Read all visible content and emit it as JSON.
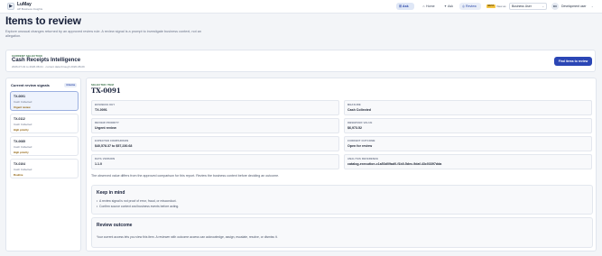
{
  "brand": {
    "logo_glyph": "▶",
    "name": "LuMay",
    "subtitle": "AP Business Insights"
  },
  "nav": {
    "ask_main": {
      "icon": "menu-icon",
      "glyph": "☰",
      "label": "Ask"
    },
    "home": {
      "icon": "home-icon",
      "glyph": "⌂",
      "label": "Home"
    },
    "ask": {
      "icon": "chat-icon",
      "glyph": "✦",
      "label": "Ask"
    },
    "review": {
      "icon": "review-icon",
      "glyph": "◎",
      "label": "Review"
    }
  },
  "beta_badge": "BETA",
  "view_as_label": "View as",
  "role_select": {
    "value": "Business User",
    "chevron": "⌄"
  },
  "user": {
    "initials": "DU",
    "name": "Development user",
    "chevron": "⌄"
  },
  "page": {
    "title": "Items to review",
    "description": "Explore unusual changes returned by an approved review rule. A review signal is a prompt to investigate business context, not an allegation."
  },
  "current_selection": {
    "eyebrow": "CURRENT SELECTION",
    "title": "Cash Receipts Intelligence",
    "meta": "2026-07-01 to 2026-08-31 · current data through 2026-08-09",
    "button_label": "Find items to review"
  },
  "signals": {
    "title": "Current review signals",
    "count_label": "4 items",
    "items": [
      {
        "id": "TX-0091",
        "area": "Cash Collected",
        "priority": "Urgent review"
      },
      {
        "id": "TX-0112",
        "area": "Cash Collected",
        "priority": "High priority"
      },
      {
        "id": "TX-0085",
        "area": "Cash Collected",
        "priority": "High priority"
      },
      {
        "id": "TX-0104",
        "area": "Cash Collected",
        "priority": "Routine"
      }
    ]
  },
  "selected": {
    "eyebrow": "SELECTED ITEM",
    "title": "TX-0091",
    "fields": [
      {
        "label": "BUSINESS KEY",
        "value": "TX-0091"
      },
      {
        "label": "MEASURE",
        "value": "Cash Collected"
      },
      {
        "label": "REVIEW PRIORITY",
        "value": "Urgent review"
      },
      {
        "label": "OBSERVED VALUE",
        "value": "$6,973.52"
      },
      {
        "label": "EXPECTED COMPARISON",
        "value": "$40,578.37 to $57,230.68"
      },
      {
        "label": "CURRENT OUTCOME",
        "value": "Open for review"
      },
      {
        "label": "DATA VERSION",
        "value": "1.1.0"
      },
      {
        "label": "ANALYSIS REFERENCE",
        "value": "catalog-execution-c1a53d09ad0-f1b0-5dec-9daf-43c03397dda"
      }
    ],
    "note": "The observed value differs from the approved comparison for this report. Review the business context before deciding an outcome."
  },
  "keep_in_mind": {
    "title": "Keep in mind",
    "lines": [
      "A review signal is not proof of error, fraud, or misconduct.",
      "Confirm source context and business events before acting."
    ]
  },
  "review_outcome": {
    "title": "Review outcome",
    "text": "Your current access lets you view this item. A reviewer with outcome access can acknowledge, assign, escalate, resolve, or dismiss it."
  }
}
